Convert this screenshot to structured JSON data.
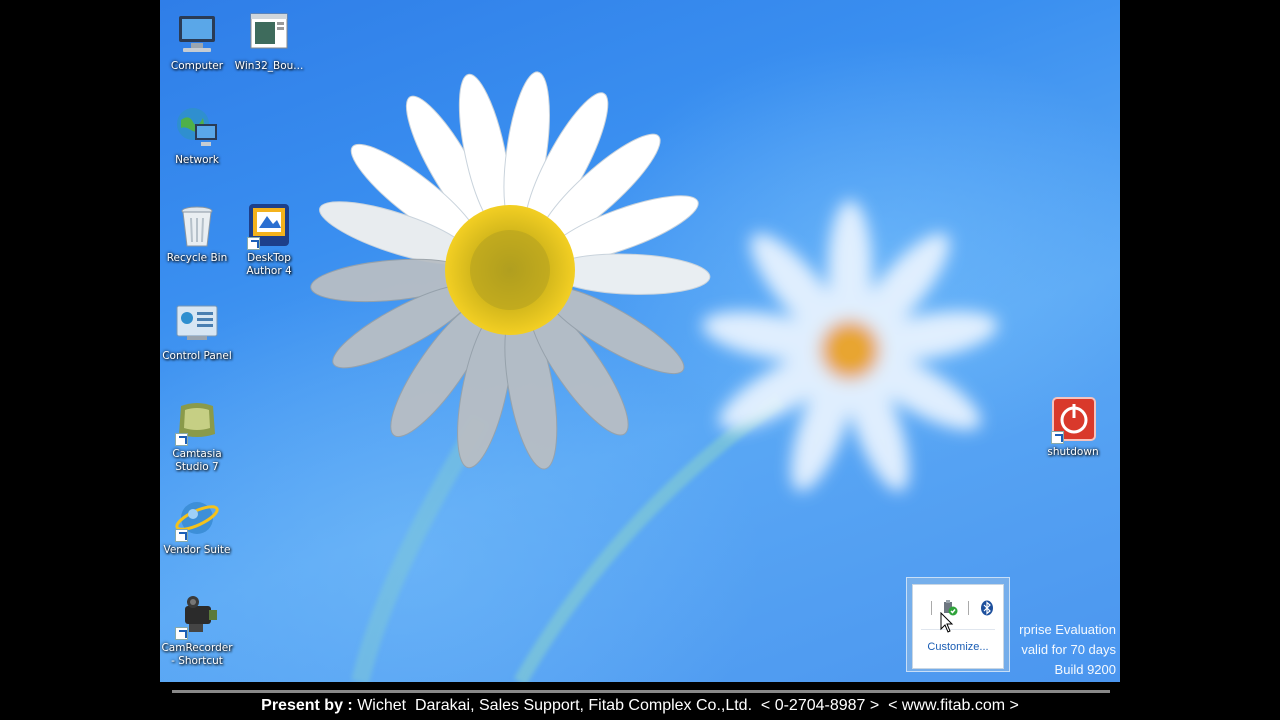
{
  "desktop": {
    "icons": [
      {
        "label": "Computer",
        "icon": "computer-icon",
        "shortcut": false
      },
      {
        "label": "Win32_Bou...",
        "icon": "window-icon",
        "shortcut": false
      },
      {
        "label": "Network",
        "icon": "network-globe-icon",
        "shortcut": false
      },
      {
        "label": "Recycle Bin",
        "icon": "recycle-bin-icon",
        "shortcut": false
      },
      {
        "label": "DeskTop Author 4",
        "icon": "desktop-author-icon",
        "shortcut": true
      },
      {
        "label": "Control Panel",
        "icon": "control-panel-icon",
        "shortcut": false
      },
      {
        "label": "Camtasia Studio 7",
        "icon": "camtasia-icon",
        "shortcut": true
      },
      {
        "label": "Vendor Suite",
        "icon": "vendor-suite-icon",
        "shortcut": true
      },
      {
        "label": "CamRecorder - Shortcut",
        "icon": "camcorder-icon",
        "shortcut": true
      },
      {
        "label": "shutdown",
        "icon": "power-icon",
        "shortcut": true
      }
    ]
  },
  "watermark": {
    "line1": "rprise Evaluation",
    "line2": "valid for 70 days",
    "line3": "Build 9200"
  },
  "tray_popup": {
    "icons": [
      "safely-remove-hardware-icon",
      "bluetooth-icon"
    ],
    "customize_label": "Customize..."
  },
  "caption": {
    "prefix": "Present by : ",
    "body": "Wichet  Darakai, Sales Support, Fitab Complex Co.,Ltd.  < 0-2704-8987 >  < www.fitab.com >"
  },
  "colors": {
    "accent_link": "#1a5db4",
    "shutdown_red": "#d9392b"
  }
}
